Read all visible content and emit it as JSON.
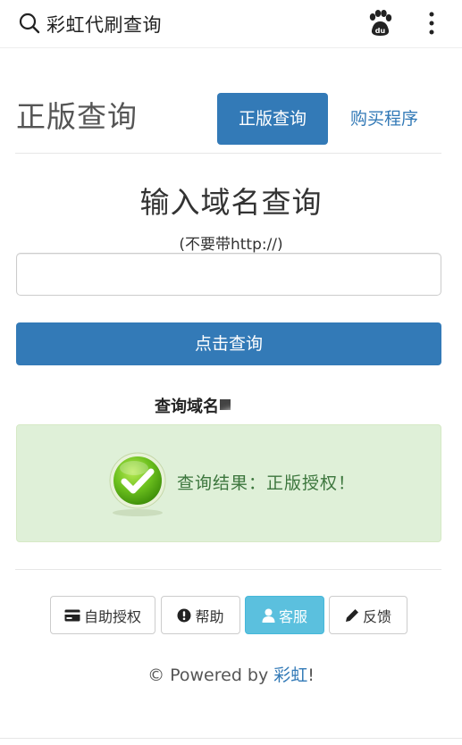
{
  "browser": {
    "title": "彩虹代刷查询",
    "search_icon": "search-icon",
    "paw_icon": "baidu-paw-icon",
    "paw_text": "du",
    "menu_icon": "more-vertical-icon"
  },
  "header": {
    "title": "正版查询",
    "primary_button": "正版查询",
    "secondary_link": "购买程序"
  },
  "form": {
    "title": "输入域名查询",
    "hint": "(不要带http://)",
    "input_value": "",
    "input_placeholder": "",
    "submit_label": "点击查询"
  },
  "result": {
    "domain_label": "查询域名",
    "status_icon": "check-circle-icon",
    "message": "查询结果：正版授权！"
  },
  "footer": {
    "buttons": [
      {
        "label": "自助授权",
        "icon": "credit-card-icon"
      },
      {
        "label": "帮助",
        "icon": "exclamation-circle-icon"
      },
      {
        "label": "客服",
        "icon": "user-icon"
      },
      {
        "label": "反馈",
        "icon": "pencil-icon"
      }
    ],
    "powered_prefix": "© Powered by ",
    "powered_brand": "彩虹",
    "powered_suffix": "!"
  },
  "colors": {
    "primary": "#337ab7",
    "success_bg": "#dff0d8",
    "success_text": "#3c763d",
    "info": "#5bc0de"
  }
}
